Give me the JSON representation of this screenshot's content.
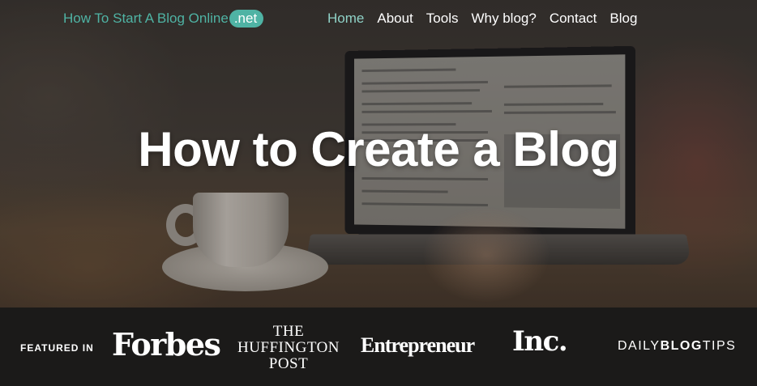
{
  "site": {
    "logo_text": "How To Start A Blog Online",
    "logo_tld": ".net",
    "accent_color": "#4fb3a4"
  },
  "nav": {
    "items": [
      {
        "label": "Home",
        "active": true
      },
      {
        "label": "About",
        "active": false
      },
      {
        "label": "Tools",
        "active": false
      },
      {
        "label": "Why blog?",
        "active": false
      },
      {
        "label": "Contact",
        "active": false
      },
      {
        "label": "Blog",
        "active": false
      }
    ]
  },
  "hero": {
    "title": "How to Create a Blog"
  },
  "featured": {
    "label": "FEATURED IN",
    "publications": {
      "forbes": "Forbes",
      "huffington": [
        "THE",
        "HUFFINGTON",
        "POST"
      ],
      "entrepreneur": "Entrepreneur",
      "inc": "Inc.",
      "dailyblogtips": {
        "part1": "DAILY",
        "part2": "BLOG",
        "part3": "TIPS"
      }
    }
  }
}
